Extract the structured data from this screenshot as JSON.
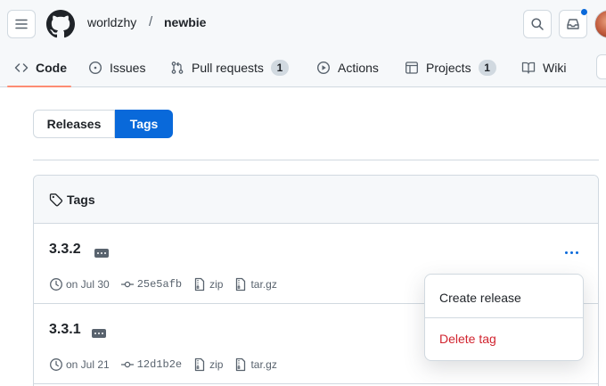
{
  "header": {
    "owner": "worldzhy",
    "separator": "/",
    "repo": "newbie",
    "icons": [
      "menu-icon",
      "github-logo-icon",
      "search-icon",
      "inbox-icon",
      "avatar"
    ],
    "accent": "#0969da"
  },
  "nav": {
    "tabs": [
      {
        "label": "Code",
        "icon": "code-icon",
        "active": true
      },
      {
        "label": "Issues",
        "icon": "issue-icon"
      },
      {
        "label": "Pull requests",
        "icon": "pull-request-icon",
        "count": "1"
      },
      {
        "label": "Actions",
        "icon": "play-icon"
      },
      {
        "label": "Projects",
        "icon": "table-icon",
        "count": "1"
      },
      {
        "label": "Wiki",
        "icon": "book-icon"
      }
    ],
    "active_underline_color": "#fd8c73"
  },
  "toggle": {
    "releases": "Releases",
    "tags": "Tags",
    "selected": "Tags"
  },
  "tags_box": {
    "title": "Tags",
    "rows": [
      {
        "name": "3.3.2",
        "date": "on Jul 30",
        "commit": "25e5afb",
        "zip": "zip",
        "targz": "tar.gz"
      },
      {
        "name": "3.3.1",
        "date": "on Jul 21",
        "commit": "12d1b2e",
        "zip": "zip",
        "targz": "tar.gz"
      }
    ]
  },
  "dropdown": {
    "create": "Create release",
    "delete": "Delete tag",
    "danger_color": "#d1242f"
  }
}
